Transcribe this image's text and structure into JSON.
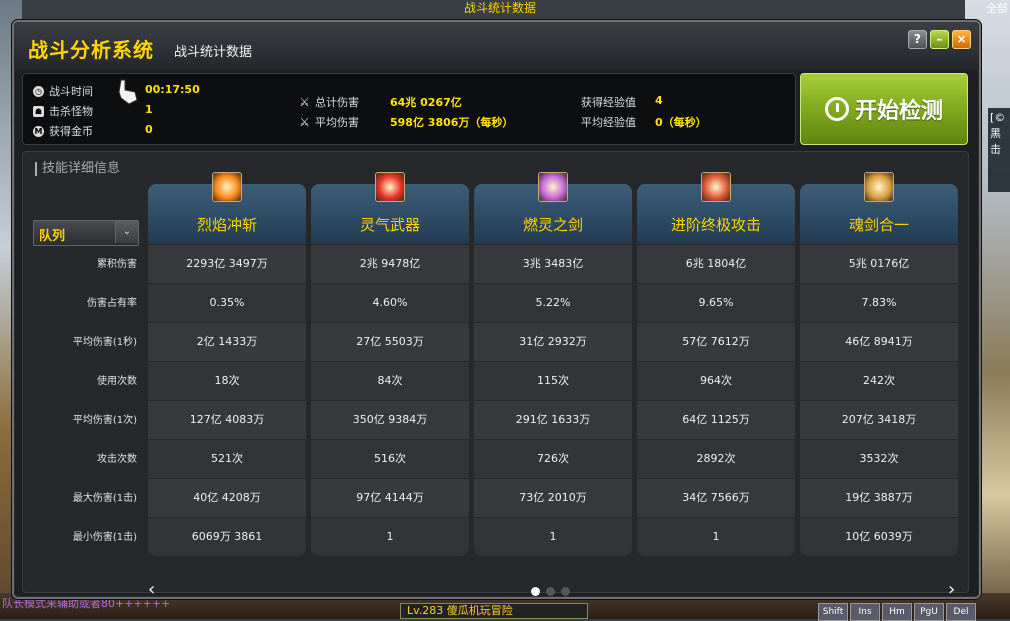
{
  "topbar": {
    "title": "战斗统计数据",
    "right_text": "全部"
  },
  "window": {
    "title": "战斗分析系统",
    "subtitle": "战斗统计数据",
    "buttons": {
      "help": "?",
      "minimize": "–",
      "close": "×"
    }
  },
  "stats": {
    "battle_time_label": "战斗时间",
    "battle_time": "00:17:50",
    "kills_label": "击杀怪物",
    "kills": "1",
    "gold_label": "获得金币",
    "gold": "0",
    "total_damage_label": "总计伤害",
    "total_damage": "64兆 0267亿",
    "avg_damage_label": "平均伤害",
    "avg_damage": "598亿 3806万（每秒）",
    "exp_label": "获得经验值",
    "exp": "4",
    "avg_exp_label": "平均经验值",
    "avg_exp": "0（每秒）"
  },
  "start_button": {
    "label": "开始检测"
  },
  "detail": {
    "title": "技能详细信息",
    "dropdown_value": "队列",
    "row_labels": [
      "累积伤害",
      "伤害占有率",
      "平均伤害(1秒)",
      "使用次数",
      "平均伤害(1次)",
      "攻击次数",
      "最大伤害(1击)",
      "最小伤害(1击)"
    ],
    "skills": [
      {
        "name": "烈焰冲斩",
        "icon": "flame-slash-icon",
        "color": "#ff8a1a",
        "values": [
          "2293亿 3497万",
          "0.35%",
          "2亿 1433万",
          "18次",
          "127亿 4083万",
          "521次",
          "40亿 4208万",
          "6069万 3861"
        ]
      },
      {
        "name": "灵气武器",
        "icon": "aura-weapon-icon",
        "color": "#e8342a",
        "values": [
          "2兆 9478亿",
          "4.60%",
          "27亿 5503万",
          "84次",
          "350亿 9384万",
          "516次",
          "97亿 4144万",
          "1"
        ]
      },
      {
        "name": "燃灵之剑",
        "icon": "soul-burn-sword-icon",
        "color": "#c66ad8",
        "values": [
          "3兆 3483亿",
          "5.22%",
          "31亿 2932万",
          "115次",
          "291亿 1633万",
          "726次",
          "73亿 2010万",
          "1"
        ]
      },
      {
        "name": "进阶终极攻击",
        "icon": "advanced-final-attack-icon",
        "color": "#e05a3a",
        "values": [
          "6兆 1804亿",
          "9.65%",
          "57亿 7612万",
          "964次",
          "64亿 1125万",
          "2892次",
          "34亿 7566万",
          "1"
        ]
      },
      {
        "name": "魂剑合一",
        "icon": "soul-sword-union-icon",
        "color": "#d8a040",
        "values": [
          "5兆 0176亿",
          "7.83%",
          "46亿 8941万",
          "242次",
          "207亿 3418万",
          "3532次",
          "19亿 3887万",
          "10亿 6039万"
        ]
      }
    ],
    "pagination": {
      "pages": 3,
      "current": 1
    }
  },
  "background": {
    "chat_line": "队长模式来辅助或者80++++++",
    "level_text": "Lv.283  傻瓜机玩冒险",
    "side_panel": "[©\n黑\n击",
    "hotkeys": [
      "Shift",
      "Ins",
      "Hm",
      "PgU",
      "Del"
    ]
  }
}
